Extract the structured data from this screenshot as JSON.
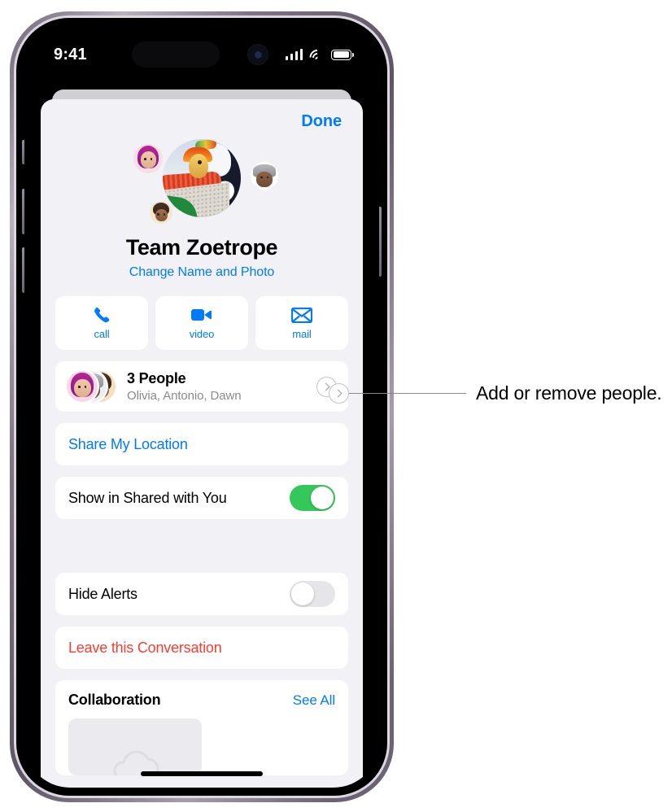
{
  "status_bar": {
    "time": "9:41",
    "signal_icon": "cellular-bars-icon",
    "wifi_icon": "wifi-icon",
    "battery_icon": "battery-icon"
  },
  "sheet": {
    "done_label": "Done",
    "group_name": "Team Zoetrope",
    "change_name_photo_label": "Change Name and Photo"
  },
  "actions": [
    {
      "label": "call",
      "icon": "phone-icon"
    },
    {
      "label": "video",
      "icon": "video-camera-icon"
    },
    {
      "label": "mail",
      "icon": "envelope-icon"
    }
  ],
  "people_row": {
    "title": "3 People",
    "subtitle": "Olivia, Antonio, Dawn",
    "chevron_icon": "chevron-right-icon"
  },
  "rows": {
    "share_location_label": "Share My Location",
    "show_shared_label": "Show in Shared with You",
    "show_shared_state": "on",
    "hide_alerts_label": "Hide Alerts",
    "hide_alerts_state": "off",
    "leave_conversation_label": "Leave this Conversation"
  },
  "collaboration": {
    "title": "Collaboration",
    "see_all_label": "See All",
    "tile_icon": "cloud-icon"
  },
  "annotation": {
    "text": "Add or remove people."
  },
  "colors": {
    "accent_blue": "#007AFF",
    "destructive_red": "#FF3B30",
    "toggle_on_green": "#34C759",
    "sheet_background": "#F2F1F6",
    "card_white": "#FFFFFF",
    "secondary_text": "#8A8A8E"
  }
}
